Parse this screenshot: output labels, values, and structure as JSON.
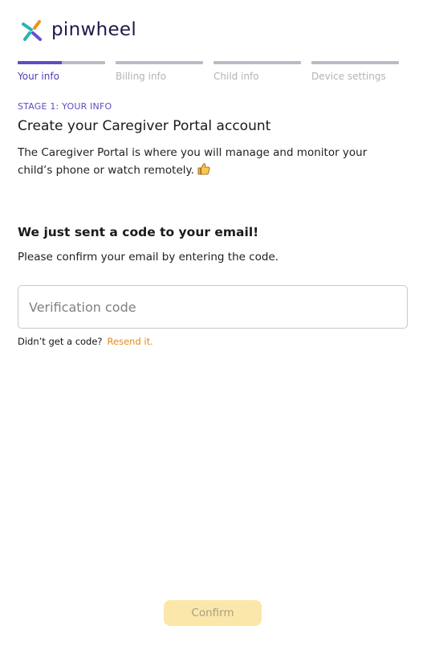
{
  "brand": {
    "name": "pinwheel",
    "colors": {
      "teal": "#2bb3b1",
      "orange": "#f0901e",
      "purple": "#6b4fc9",
      "navy": "#1c1a4a"
    }
  },
  "stepper": {
    "steps": [
      {
        "label": "Your info",
        "progress": 0.5
      },
      {
        "label": "Billing info",
        "progress": 0
      },
      {
        "label": "Child info",
        "progress": 0
      },
      {
        "label": "Device settings",
        "progress": 0
      }
    ]
  },
  "stage_label": "STAGE 1: YOUR INFO",
  "title": "Create your Caregiver Portal account",
  "description": "The Caregiver Portal is where you will manage and monitor your child’s phone or watch remotely.",
  "description_icon": "thumbs-up-icon",
  "code_section": {
    "heading": "We just sent a code to your email!",
    "subtext": "Please confirm your email by entering the code.",
    "input_placeholder": "Verification code",
    "input_value": "",
    "resend_question": "Didn’t get a code?",
    "resend_link": "Resend it."
  },
  "confirm_button": {
    "label": "Confirm",
    "state": "disabled"
  },
  "accent_colors": {
    "primary": "#5b4fc2",
    "link": "#e08a1e",
    "button_disabled": "#fbe7a9"
  }
}
